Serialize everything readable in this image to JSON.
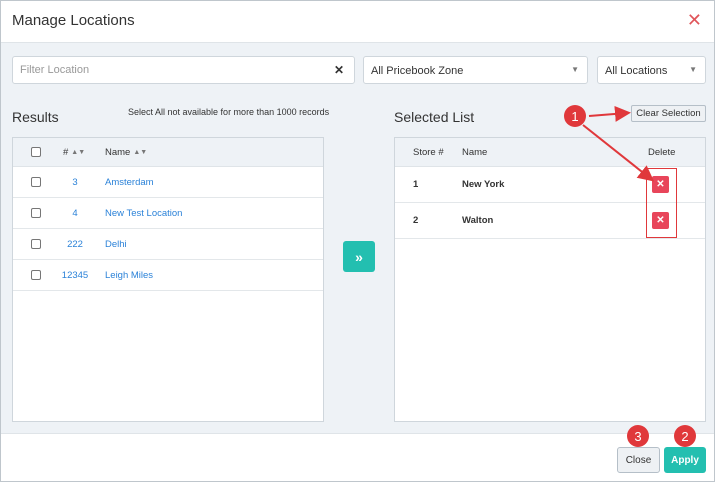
{
  "dialog": {
    "title": "Manage Locations"
  },
  "filters": {
    "filter_placeholder": "Filter Location",
    "filter_value": "",
    "pricebook_zone": "All Pricebook Zone",
    "locations": "All Locations"
  },
  "results": {
    "title": "Results",
    "note": "Select All not available for more than 1000 records",
    "columns": {
      "number": "#",
      "name": "Name"
    },
    "rows": [
      {
        "number": "3",
        "name": "Amsterdam"
      },
      {
        "number": "4",
        "name": "New Test Location"
      },
      {
        "number": "222",
        "name": "Delhi"
      },
      {
        "number": "12345",
        "name": "Leigh Miles"
      }
    ]
  },
  "selected": {
    "title": "Selected List",
    "clear_label": "Clear Selection",
    "columns": {
      "store": "Store #",
      "name": "Name",
      "delete": "Delete"
    },
    "rows": [
      {
        "store": "1",
        "name": "New York"
      },
      {
        "store": "2",
        "name": "Walton"
      }
    ]
  },
  "footer": {
    "close_label": "Close",
    "apply_label": "Apply"
  },
  "callouts": {
    "one": "1",
    "two": "2",
    "three": "3"
  },
  "colors": {
    "accent": "#23bfb0",
    "danger": "#e8455a",
    "link": "#2b82d8",
    "callout": "#e0383b"
  }
}
